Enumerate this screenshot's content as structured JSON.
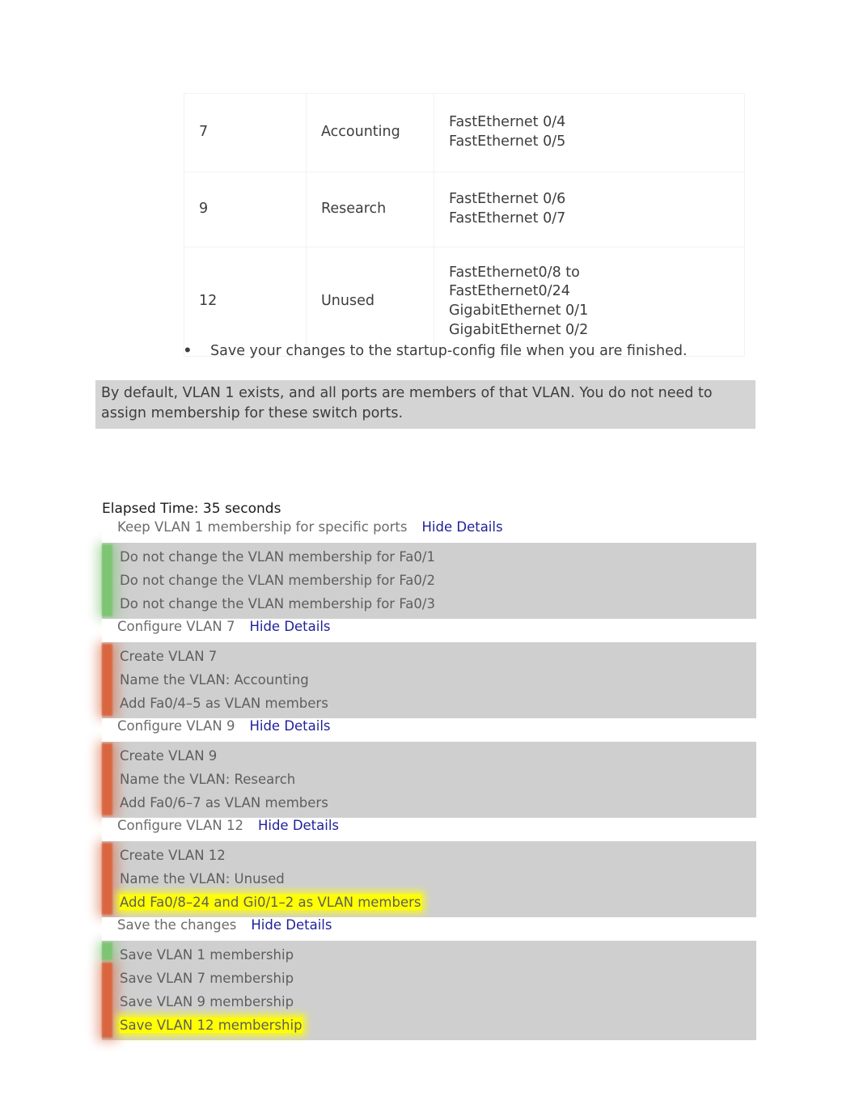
{
  "vlan_table": {
    "rows": [
      {
        "id": "7",
        "name": "Accounting",
        "ports": [
          "FastEthernet 0/4",
          "FastEthernet 0/5"
        ]
      },
      {
        "id": "9",
        "name": "Research",
        "ports": [
          "FastEthernet 0/6",
          "FastEthernet 0/7"
        ]
      },
      {
        "id": "12",
        "name": "Unused",
        "ports": [
          "FastEthernet0/8 to",
          "FastEthernet0/24",
          "GigabitEthernet 0/1",
          "GigabitEthernet 0/2"
        ]
      }
    ]
  },
  "bullet": {
    "marker": "•",
    "text": "Save your changes to the startup-config file when you are finished."
  },
  "note": {
    "text": "By default, VLAN 1 exists, and all ports are members of that VLAN. You do not need to assign membership for these switch ports."
  },
  "checklist": {
    "elapsed_time": "Elapsed Time: 35 seconds",
    "hide_details_label": "Hide Details",
    "sections": [
      {
        "title": "Keep VLAN 1 membership for specific ports",
        "status": "green",
        "items": [
          {
            "text": "Do not change the VLAN membership for Fa0/1",
            "highlight": false
          },
          {
            "text": "Do not change the VLAN membership for Fa0/2",
            "highlight": false
          },
          {
            "text": "Do not change the VLAN membership for Fa0/3",
            "highlight": false
          }
        ]
      },
      {
        "title": "Configure VLAN 7",
        "status": "red",
        "items": [
          {
            "text": "Create VLAN 7",
            "highlight": false
          },
          {
            "text": "Name the VLAN: Accounting",
            "highlight": false
          },
          {
            "text": "Add Fa0/4–5 as VLAN members",
            "highlight": false
          }
        ]
      },
      {
        "title": "Configure VLAN 9",
        "status": "red",
        "items": [
          {
            "text": "Create VLAN 9",
            "highlight": false
          },
          {
            "text": "Name the VLAN: Research",
            "highlight": false
          },
          {
            "text": "Add Fa0/6–7 as VLAN members",
            "highlight": false
          }
        ]
      },
      {
        "title": "Configure VLAN 12",
        "status": "red",
        "items": [
          {
            "text": "Create VLAN 12",
            "highlight": false
          },
          {
            "text": "Name the VLAN: Unused",
            "highlight": false
          },
          {
            "text": "Add Fa0/8–24 and Gi0/1–2 as VLAN members",
            "highlight": true
          }
        ]
      },
      {
        "title": "Save the changes",
        "status": "mixed",
        "items": [
          {
            "text": "Save VLAN 1 membership",
            "highlight": false,
            "status": "green"
          },
          {
            "text": "Save VLAN 7 membership",
            "highlight": false,
            "status": "red"
          },
          {
            "text": "Save VLAN 9 membership",
            "highlight": false,
            "status": "red"
          },
          {
            "text": "Save VLAN 12 membership",
            "highlight": true,
            "status": "red"
          }
        ]
      }
    ]
  },
  "colors": {
    "status_pass": "#7dc473",
    "status_fail": "#d9663f",
    "highlight": "#ffff00",
    "detail_bg": "#cfcfcf",
    "note_bg": "#d4d4d4",
    "link": "#1f1f99"
  }
}
